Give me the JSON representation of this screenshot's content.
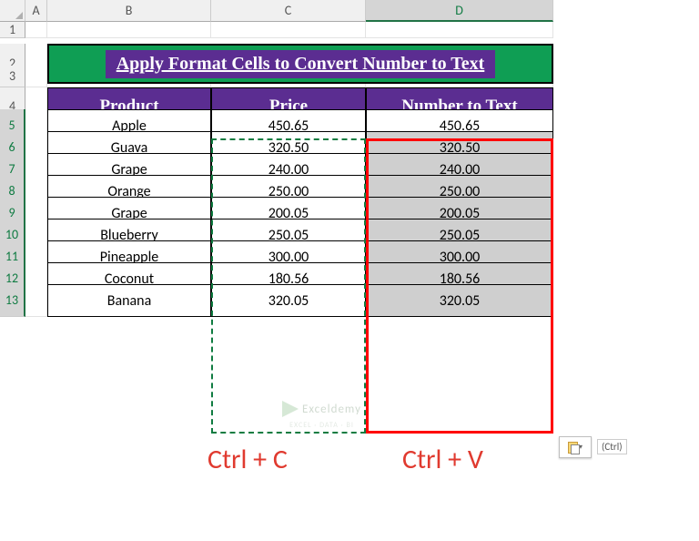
{
  "columns": [
    "A",
    "B",
    "C",
    "D"
  ],
  "rows": [
    "1",
    "2",
    "3",
    "4",
    "5",
    "6",
    "7",
    "8",
    "9",
    "10",
    "11",
    "12",
    "13"
  ],
  "title": "Apply Format Cells to Convert Number to Text",
  "headers": {
    "b": "Product",
    "c": "Price",
    "d": "Number to Text"
  },
  "data": [
    {
      "product": "Apple",
      "price": "450.65",
      "ntext": "450.65"
    },
    {
      "product": "Guava",
      "price": "320.50",
      "ntext": "320.50"
    },
    {
      "product": "Grape",
      "price": "240.00",
      "ntext": "240.00"
    },
    {
      "product": "Orange",
      "price": "250.00",
      "ntext": "250.00"
    },
    {
      "product": "Grape",
      "price": "200.05",
      "ntext": "200.05"
    },
    {
      "product": "Blueberry",
      "price": "250.05",
      "ntext": "250.05"
    },
    {
      "product": "Pineapple",
      "price": "300.00",
      "ntext": "300.00"
    },
    {
      "product": "Coconut",
      "price": "180.56",
      "ntext": "180.56"
    },
    {
      "product": "Banana",
      "price": "320.05",
      "ntext": "320.05"
    }
  ],
  "shortcuts": {
    "copy": "Ctrl + C",
    "paste": "Ctrl + V"
  },
  "paste_options_label": "(Ctrl)",
  "watermark": "Exceldemy",
  "watermark_sub": "EXCEL · DATA · BI",
  "chart_data": {
    "type": "table",
    "title": "Apply Format Cells to Convert Number to Text",
    "columns": [
      "Product",
      "Price",
      "Number to Text"
    ],
    "rows": [
      [
        "Apple",
        "450.65",
        "450.65"
      ],
      [
        "Guava",
        "320.50",
        "320.50"
      ],
      [
        "Grape",
        "240.00",
        "240.00"
      ],
      [
        "Orange",
        "250.00",
        "250.00"
      ],
      [
        "Grape",
        "200.05",
        "200.05"
      ],
      [
        "Blueberry",
        "250.05",
        "250.05"
      ],
      [
        "Pineapple",
        "300.00",
        "300.00"
      ],
      [
        "Coconut",
        "180.56",
        "180.56"
      ],
      [
        "Banana",
        "320.05",
        "320.05"
      ]
    ]
  }
}
